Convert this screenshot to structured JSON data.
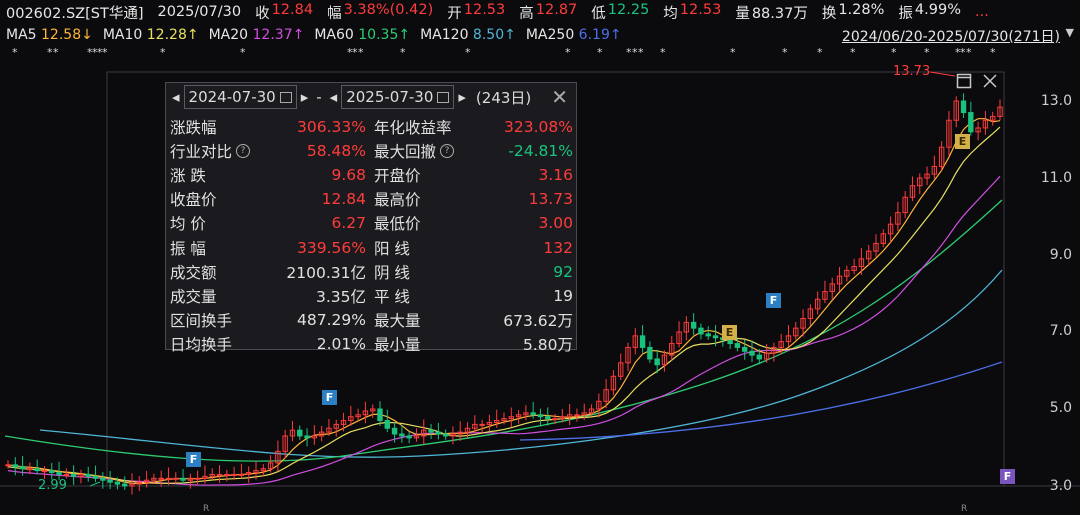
{
  "quote": {
    "symbol": "002602.SZ[ST华通]",
    "date": "2025/07/30",
    "close_label": "收",
    "close": "12.84",
    "chg_label": "幅",
    "chg": "3.38%(0.42)",
    "open_label": "开",
    "open": "12.53",
    "high_label": "高",
    "high": "12.87",
    "low_label": "低",
    "low": "12.25",
    "avg_label": "均",
    "avg": "12.53",
    "vol_label": "量",
    "vol": "88.37万",
    "turnover_label": "换",
    "turnover": "1.28%",
    "amp_label": "振",
    "amp": "4.99%",
    "more": "..."
  },
  "ma": [
    {
      "label": "MA5",
      "value": "12.58↓",
      "color": "#ffb43a"
    },
    {
      "label": "MA10",
      "value": "12.28↑",
      "color": "#e8e060"
    },
    {
      "label": "MA20",
      "value": "12.37↑",
      "color": "#d04ee0"
    },
    {
      "label": "MA60",
      "value": "10.35↑",
      "color": "#2ecc71"
    },
    {
      "label": "MA120",
      "value": "8.50↑",
      "color": "#4fb6d6"
    },
    {
      "label": "MA250",
      "value": "6.19↑",
      "color": "#4d6fe8"
    }
  ],
  "range_text": "2024/06/20-2025/07/30(271日)",
  "range_arrow": "▼",
  "star_glyph": "*",
  "y_ticks": [
    "13.0",
    "11.0",
    "9.0",
    "7.0",
    "5.0",
    "3.0"
  ],
  "price_markers": {
    "high": "13.73",
    "low": "2.99"
  },
  "r_mark": "R",
  "badges": [
    "F",
    "F",
    "E",
    "F",
    "E",
    "F"
  ],
  "popup": {
    "arrow_left": "◂",
    "arrow_right": "▸",
    "start": "2024-07-30",
    "sep": "-",
    "end": "2025-07-30",
    "days": "(243日)",
    "close": "✕",
    "rows": [
      {
        "l1": "涨跌幅",
        "v1": "306.33%",
        "c1": "#ff3b3b",
        "l2": "年化收益率",
        "v2": "323.08%",
        "c2": "#ff3b3b"
      },
      {
        "l1": "行业对比",
        "q1": true,
        "v1": "58.48%",
        "c1": "#ff3b3b",
        "l2": "最大回撤",
        "q2": true,
        "v2": "-24.81%",
        "c2": "#19c37d"
      },
      {
        "l1": "涨  跌",
        "v1": "9.68",
        "c1": "#ff3b3b",
        "l2": "开盘价",
        "v2": "3.16",
        "c2": "#ff3b3b"
      },
      {
        "l1": "收盘价",
        "v1": "12.84",
        "c1": "#ff3b3b",
        "l2": "最高价",
        "v2": "13.73",
        "c2": "#ff3b3b"
      },
      {
        "l1": "均  价",
        "v1": "6.27",
        "c1": "#ff3b3b",
        "l2": "最低价",
        "v2": "3.00",
        "c2": "#ff3b3b"
      },
      {
        "l1": "振  幅",
        "v1": "339.56%",
        "c1": "#ff3b3b",
        "l2": "阳  线",
        "v2": "132",
        "c2": "#ff3b3b"
      },
      {
        "l1": "成交额",
        "v1": "2100.31亿",
        "c1": "#e0e0e0",
        "l2": "阴  线",
        "v2": "92",
        "c2": "#19c37d"
      },
      {
        "l1": "成交量",
        "v1": "3.35亿",
        "c1": "#e0e0e0",
        "l2": "平  线",
        "v2": "19",
        "c2": "#e0e0e0"
      },
      {
        "l1": "区间换手",
        "v1": "487.29%",
        "c1": "#e0e0e0",
        "l2": "最大量",
        "v2": "673.62万",
        "c2": "#e0e0e0"
      },
      {
        "l1": "日均换手",
        "v1": "2.01%",
        "c1": "#e0e0e0",
        "l2": "最小量",
        "v2": "5.80万",
        "c2": "#e0e0e0"
      }
    ]
  },
  "chart_data": {
    "type": "candlestick",
    "y_ticks": [
      13.0,
      11.0,
      9.0,
      7.0,
      5.0,
      3.0
    ],
    "ylim": [
      3.0,
      13.73
    ],
    "x_range": [
      "2024/06/20",
      "2025/07/30"
    ],
    "period_high": 13.73,
    "period_low": 2.99,
    "close": [
      3.55,
      3.5,
      3.45,
      3.45,
      3.4,
      3.4,
      3.35,
      3.3,
      3.3,
      3.25,
      3.3,
      3.25,
      3.2,
      3.15,
      3.1,
      3.05,
      3.0,
      3.05,
      3.1,
      3.15,
      3.2,
      3.2,
      3.2,
      3.2,
      3.15,
      3.2,
      3.2,
      3.25,
      3.3,
      3.3,
      3.3,
      3.3,
      3.3,
      3.35,
      3.4,
      3.45,
      3.6,
      3.9,
      4.3,
      4.45,
      4.3,
      4.25,
      4.3,
      4.4,
      4.5,
      4.6,
      4.7,
      4.8,
      4.85,
      4.95,
      5.0,
      4.7,
      4.5,
      4.35,
      4.3,
      4.25,
      4.3,
      4.45,
      4.4,
      4.35,
      4.3,
      4.35,
      4.4,
      4.5,
      4.6,
      4.6,
      4.65,
      4.7,
      4.75,
      4.8,
      4.85,
      4.9,
      4.85,
      4.8,
      4.75,
      4.75,
      4.8,
      4.85,
      4.85,
      4.9,
      5.0,
      5.2,
      5.5,
      5.85,
      6.2,
      6.6,
      6.9,
      6.6,
      6.3,
      6.15,
      6.4,
      6.7,
      7.0,
      7.25,
      7.1,
      6.95,
      6.9,
      6.85,
      6.8,
      6.7,
      6.6,
      6.5,
      6.4,
      6.3,
      6.45,
      6.6,
      6.75,
      6.9,
      7.1,
      7.35,
      7.6,
      7.85,
      8.05,
      8.25,
      8.45,
      8.6,
      8.7,
      8.9,
      9.1,
      9.3,
      9.55,
      9.8,
      10.1,
      10.5,
      10.8,
      11.0,
      11.1,
      11.3,
      11.8,
      12.5,
      13.0,
      12.7,
      12.2,
      12.3,
      12.5,
      12.6,
      12.84
    ],
    "ma": {
      "MA5": 12.58,
      "MA10": 12.28,
      "MA20": 12.37,
      "MA60": 10.35,
      "MA120": 8.5,
      "MA250": 6.19
    }
  }
}
